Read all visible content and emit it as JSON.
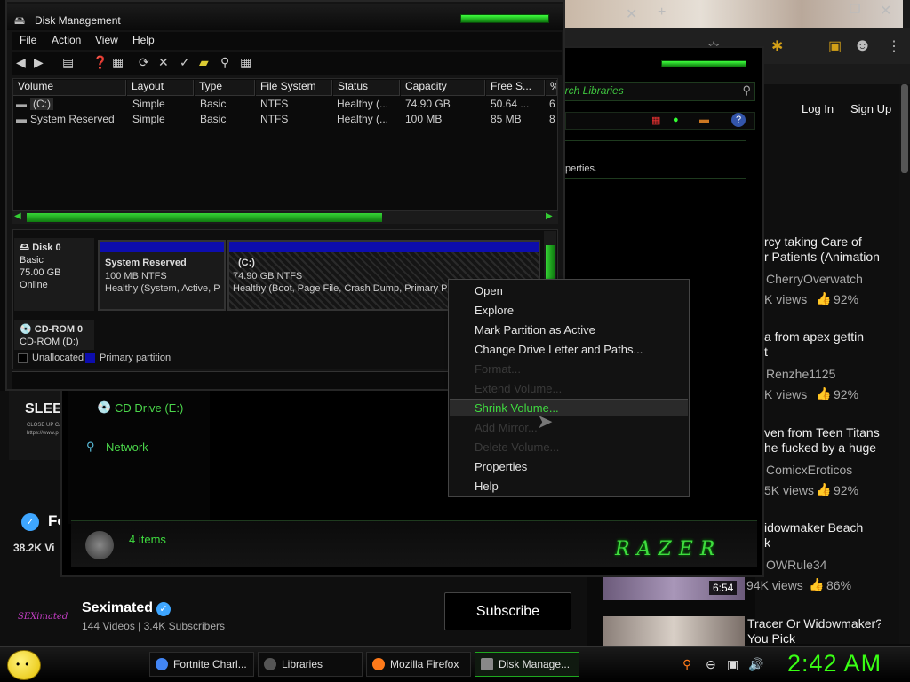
{
  "browser": {
    "login": "Log In",
    "signup": "Sign Up",
    "videos": [
      {
        "title1": "rcy taking Care of",
        "title2": "r Patients (Animation",
        "channel": "CherryOverwatch",
        "views": "K views",
        "likes": "92%"
      },
      {
        "title1": "a from apex gettin",
        "title2": "t",
        "channel": "Renzhe1125",
        "views": "K views",
        "likes": "92%"
      },
      {
        "title1": "ven from Teen Titans",
        "title2": "he fucked by a huge",
        "channel": "ComicxEroticos",
        "views": "5K views",
        "likes": "92%"
      },
      {
        "title1": "idowmaker Beach",
        "title2": "k",
        "channel": "OWRule34",
        "views": "94K views",
        "likes": "86%",
        "duration": "6:54"
      },
      {
        "title1": "Tracer Or Widowmaker?",
        "title2": "You Pick"
      }
    ]
  },
  "yt_left": {
    "sleep": "SLEEF",
    "close_up": "CLOSE UP CA",
    "url": "https://www.p",
    "fo": "Fo",
    "fo_views": "38.2K Vi",
    "channel_name": "Seximated",
    "channel_logo": "SEXimated",
    "channel_meta": "144 Videos | 3.4K Subscribers",
    "subscribe": "Subscribe"
  },
  "libraries": {
    "search_placeholder": "arch Libraries",
    "properties_hint": "perties.",
    "nav_cd": "CD Drive (E:)",
    "nav_network": "Network",
    "status_items": "4 items",
    "brand": "RAZER"
  },
  "disk_management": {
    "title": "Disk Management",
    "menu": [
      "File",
      "Action",
      "View",
      "Help"
    ],
    "columns": [
      "Volume",
      "Layout",
      "Type",
      "File System",
      "Status",
      "Capacity",
      "Free S...",
      "%"
    ],
    "rows": [
      [
        "(C:)",
        "Simple",
        "Basic",
        "NTFS",
        "Healthy (...",
        "74.90 GB",
        "50.64 ...",
        "6"
      ],
      [
        "System Reserved",
        "Simple",
        "Basic",
        "NTFS",
        "Healthy (...",
        "100 MB",
        "85 MB",
        "8"
      ]
    ],
    "disk0": {
      "name": "Disk 0",
      "type": "Basic",
      "size": "75.00 GB",
      "state": "Online"
    },
    "cdrom0": {
      "name": "CD-ROM 0",
      "sub": "CD-ROM (D:)"
    },
    "partition_sysres": {
      "name": "System Reserved",
      "size": "100 MB NTFS",
      "status": "Healthy (System, Active, P"
    },
    "partition_c": {
      "name": "(C:)",
      "size": "74.90 GB NTFS",
      "status": "Healthy (Boot, Page File, Crash Dump, Primary Part"
    },
    "legend_unallocated": "Unallocated",
    "legend_primary": "Primary partition"
  },
  "context_menu": {
    "items": [
      {
        "label": "Open",
        "enabled": true
      },
      {
        "label": "Explore",
        "enabled": true
      },
      {
        "label": "Mark Partition as Active",
        "enabled": true
      },
      {
        "label": "Change Drive Letter and Paths...",
        "enabled": true
      },
      {
        "label": "Format...",
        "enabled": false
      },
      {
        "label": "Extend Volume...",
        "enabled": false
      },
      {
        "label": "Shrink Volume...",
        "enabled": true,
        "highlighted": true
      },
      {
        "label": "Add Mirror...",
        "enabled": false
      },
      {
        "label": "Delete Volume...",
        "enabled": false
      },
      {
        "label": "Properties",
        "enabled": true
      },
      {
        "label": "Help",
        "enabled": true
      }
    ]
  },
  "taskbar": {
    "tasks": [
      {
        "label": "Fortnite Charl...",
        "icon_color": "#4285f4"
      },
      {
        "label": "Libraries",
        "icon_color": "#555555"
      },
      {
        "label": "Mozilla Firefox",
        "icon_color": "#ff7a1a"
      },
      {
        "label": "Disk Manage...",
        "icon_color": "#888888",
        "active": true
      }
    ],
    "clock": "2:42 AM"
  },
  "colors": {
    "accent": "#39ff14",
    "partition_blue": "#0d0dad"
  }
}
